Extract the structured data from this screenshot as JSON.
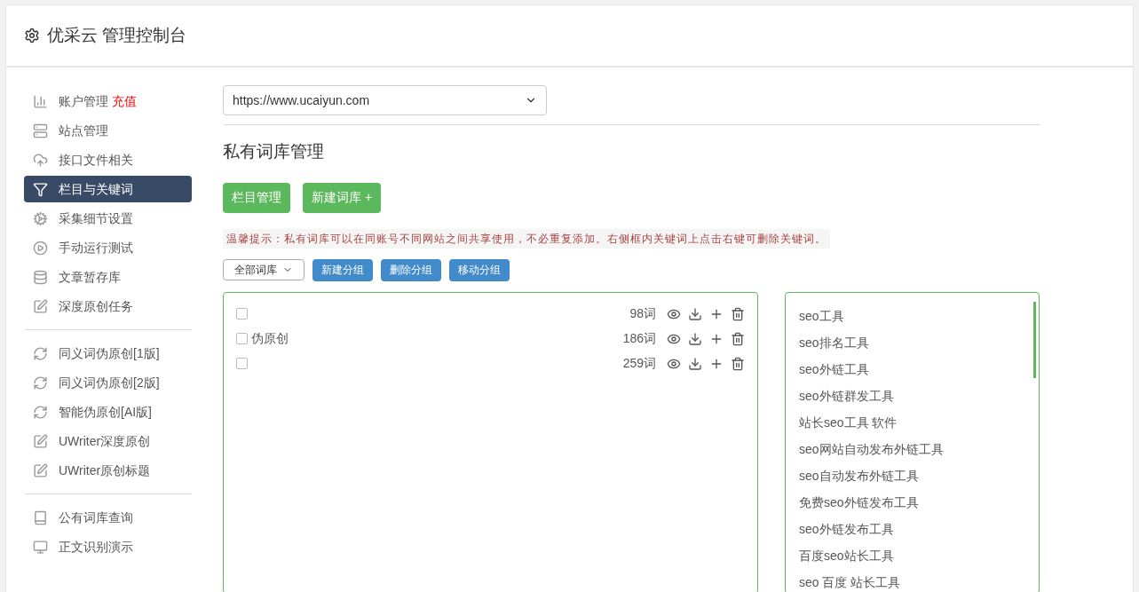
{
  "header": {
    "title": "优采云 管理控制台"
  },
  "sidebar": {
    "groups": [
      {
        "items": [
          {
            "label": "账户管理",
            "badge": "充值",
            "selected": false
          },
          {
            "label": "站点管理",
            "selected": false
          },
          {
            "label": "接口文件相关",
            "selected": false
          },
          {
            "label": "栏目与关键词",
            "selected": true
          },
          {
            "label": "采集细节设置",
            "selected": false
          },
          {
            "label": "手动运行测试",
            "selected": false
          },
          {
            "label": "文章暂存库",
            "selected": false
          },
          {
            "label": "深度原创任务",
            "selected": false
          }
        ]
      },
      {
        "items": [
          {
            "label": "同义词伪原创[1版]",
            "selected": false
          },
          {
            "label": "同义词伪原创[2版]",
            "selected": false
          },
          {
            "label": "智能伪原创[AI版]",
            "selected": false
          },
          {
            "label": "UWriter深度原创",
            "selected": false
          },
          {
            "label": "UWriter原创标题",
            "selected": false
          }
        ]
      },
      {
        "items": [
          {
            "label": "公有词库查询",
            "selected": false
          },
          {
            "label": "正文识别演示",
            "selected": false
          }
        ]
      }
    ]
  },
  "site_select": {
    "value": "https://www.ucaiyun.com"
  },
  "section_title": "私有词库管理",
  "action_buttons": [
    "栏目管理",
    "新建词库 +"
  ],
  "tip": "温馨提示：私有词库可以在同账号不同网站之间共享使用，不必重复添加。右侧框内关键词上点击右键可删除关键词。",
  "group_select": {
    "value": "全部词库"
  },
  "group_buttons": [
    "新建分组",
    "删除分组",
    "移动分组"
  ],
  "libraries": [
    {
      "count": "98词",
      "checked": false
    },
    {
      "name": "伪原创",
      "count": "186词",
      "checked": false
    },
    {
      "count": "259词",
      "checked": false
    }
  ],
  "keywords": [
    "seo工具",
    "seo排名工具",
    "seo外链工具",
    "seo外链群发工具",
    "站长seo工具 软件",
    "seo网站自动发布外链工具",
    "seo自动发布外链工具",
    "免费seo外链发布工具",
    "seo外链发布工具",
    "百度seo站长工具",
    "seo 百度 站长工具"
  ]
}
